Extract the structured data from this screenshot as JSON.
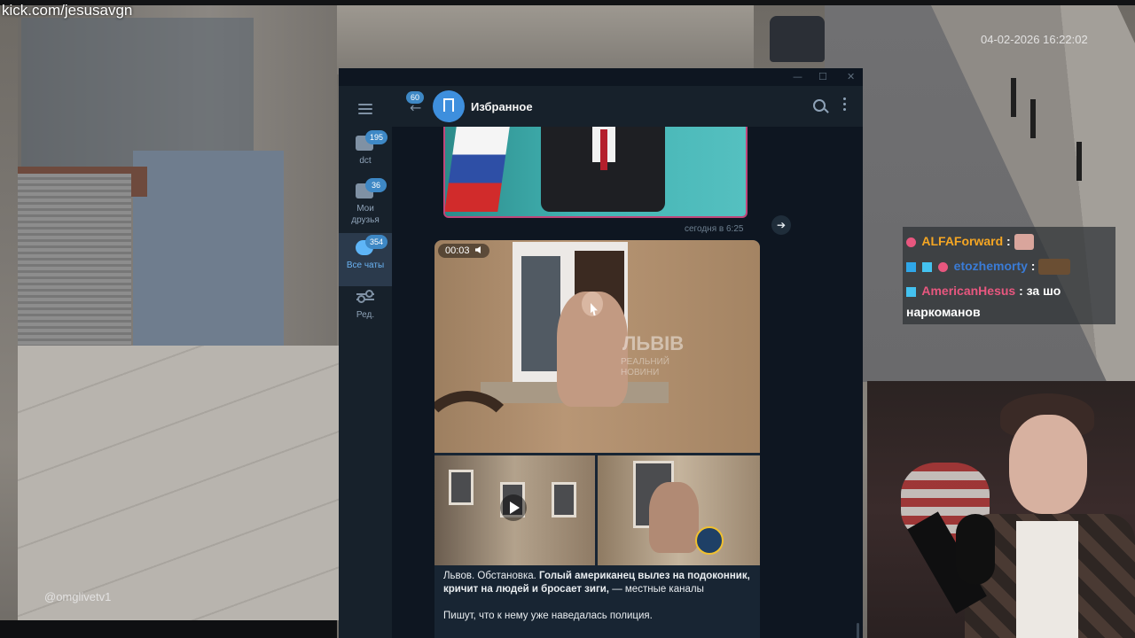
{
  "stream": {
    "url": "kick.com/jesusavgn",
    "timestamp": "04-02-2026 16:22:02",
    "camera_handle": "@omglivetv1"
  },
  "telegram": {
    "window_controls": {
      "minimize": "—",
      "maximize": "☐",
      "close": "✕"
    },
    "unread_badge": "60",
    "chat_title": "Избранное",
    "folders": [
      {
        "label": "dct",
        "badge": "195",
        "icon": "chat-bubble-icon"
      },
      {
        "label": "Мои друзья",
        "badge": "36",
        "icon": "chat-bubble-icon"
      },
      {
        "label": "Все чаты",
        "badge": "354",
        "icon": "chats-icon",
        "active": true
      },
      {
        "label": "Ред.",
        "icon": "sliders-icon"
      }
    ],
    "messages": {
      "previous_time": "сегодня в 6:25",
      "video_duration": "00:03",
      "watermark": "ЛЬВІВ",
      "watermark_sub": "РЕАЛЬНИЙ\nНОВИНИ",
      "caption_lead": "Львов. Обстановка. ",
      "caption_bold": "Голый американец вылез на подоконник, кричит на людей и бросает зиги,",
      "caption_tail": " — местные каналы",
      "caption_p2": "Пишут, что к нему уже наведалась полиция."
    }
  },
  "chat_overlay": {
    "lines": [
      {
        "user": "ALFAForward",
        "sep": ":",
        "message": "",
        "color": "#f5a623"
      },
      {
        "user": "etozhemorty",
        "sep": ":",
        "message": "",
        "color": "#3a7bd5"
      },
      {
        "user": "AmericanHesus",
        "sep": ":",
        "message": "за шо",
        "message2": "наркоманов",
        "color": "#e8577f"
      }
    ]
  },
  "colors": {
    "telegram_bg": "#0e1621",
    "telegram_sidebar": "#17212b",
    "accent": "#5eb5f7",
    "badge": "#3e88c5"
  }
}
